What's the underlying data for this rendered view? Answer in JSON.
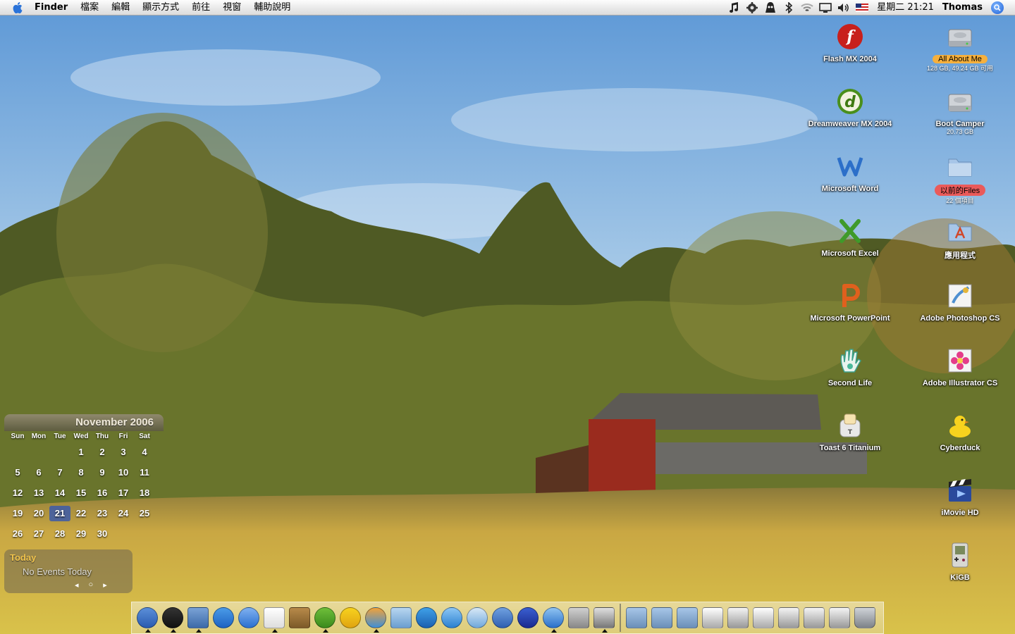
{
  "menubar": {
    "app_name": "Finder",
    "menus": [
      "檔案",
      "編輯",
      "顯示方式",
      "前往",
      "視窗",
      "輔助說明"
    ],
    "status_icons": [
      "itunes-note-icon",
      "gear-icon",
      "snitch-icon",
      "bluetooth-icon",
      "wifi-icon",
      "display-icon",
      "volume-icon",
      "us-flag-input-icon"
    ],
    "clock": "星期二 21:21",
    "user": "Thomas"
  },
  "desktop": {
    "left_column": [
      {
        "label": "Flash MX 2004",
        "icon": "flash-icon"
      },
      {
        "label": "Dreamweaver MX 2004",
        "icon": "dreamweaver-icon"
      },
      {
        "label": "Microsoft Word",
        "icon": "word-icon"
      },
      {
        "label": "Microsoft Excel",
        "icon": "excel-icon"
      },
      {
        "label": "Microsoft PowerPoint",
        "icon": "powerpoint-icon"
      },
      {
        "label": "Second Life",
        "icon": "second-life-icon"
      },
      {
        "label": "Toast 6 Titanium",
        "icon": "toast-icon"
      }
    ],
    "right_column": [
      {
        "label": "All About Me",
        "sub": "128 GB, 49.24 GB 可用",
        "icon": "hard-drive-icon"
      },
      {
        "label": "Boot Camper",
        "sub": "20.73 GB",
        "icon": "hard-drive-icon"
      },
      {
        "label": "以前的Files",
        "sub": "22 個項目",
        "icon": "folder-icon"
      },
      {
        "label": "應用程式",
        "sub": "",
        "icon": "applications-folder-icon"
      },
      {
        "label": "Adobe Photoshop CS",
        "sub": "",
        "icon": "photoshop-icon"
      },
      {
        "label": "Adobe Illustrator CS",
        "sub": "",
        "icon": "illustrator-icon"
      },
      {
        "label": "Cyberduck",
        "sub": "",
        "icon": "cyberduck-icon"
      },
      {
        "label": "iMovie HD",
        "sub": "",
        "icon": "imovie-icon"
      },
      {
        "label": "KiGB",
        "sub": "",
        "icon": "kigb-icon"
      }
    ]
  },
  "calendar_widget": {
    "month_title": "November 2006",
    "weekdays": [
      "Sun",
      "Mon",
      "Tue",
      "Wed",
      "Thu",
      "Fri",
      "Sat"
    ],
    "days": [
      "",
      "",
      "",
      "1",
      "2",
      "3",
      "4",
      "5",
      "6",
      "7",
      "8",
      "9",
      "10",
      "11",
      "12",
      "13",
      "14",
      "15",
      "16",
      "17",
      "18",
      "19",
      "20",
      "21",
      "22",
      "23",
      "24",
      "25",
      "26",
      "27",
      "28",
      "29",
      "30",
      "",
      ""
    ],
    "today": "21",
    "today_label": "Today",
    "events_text": "No Events Today"
  },
  "dock": {
    "apps": [
      "finder-icon",
      "dashboard-icon",
      "preview-icon",
      "safari-icon",
      "ichat-icon",
      "ical-icon",
      "address-book-icon",
      "adium-icon",
      "yahoo-messenger-icon",
      "msn-messenger-icon",
      "mail-icon",
      "quicktime-icon",
      "coherence-play-icon",
      "remote-icon",
      "bluetooth-icon",
      "wizard-icon",
      "itunes-icon",
      "system-preferences-icon",
      "iphoto-icon"
    ],
    "running": [
      "finder-icon",
      "dashboard-icon",
      "preview-icon",
      "ical-icon",
      "adium-icon",
      "msn-messenger-icon",
      "itunes-icon",
      "iphoto-icon"
    ],
    "docs": [
      "folder-stack-icon",
      "folder-stack-icon",
      "folder-stack-icon",
      "document-icon",
      "window-thumb-icon",
      "document-icon",
      "window-thumb-icon",
      "window-thumb-icon",
      "window-thumb-icon",
      "trash-icon"
    ]
  }
}
